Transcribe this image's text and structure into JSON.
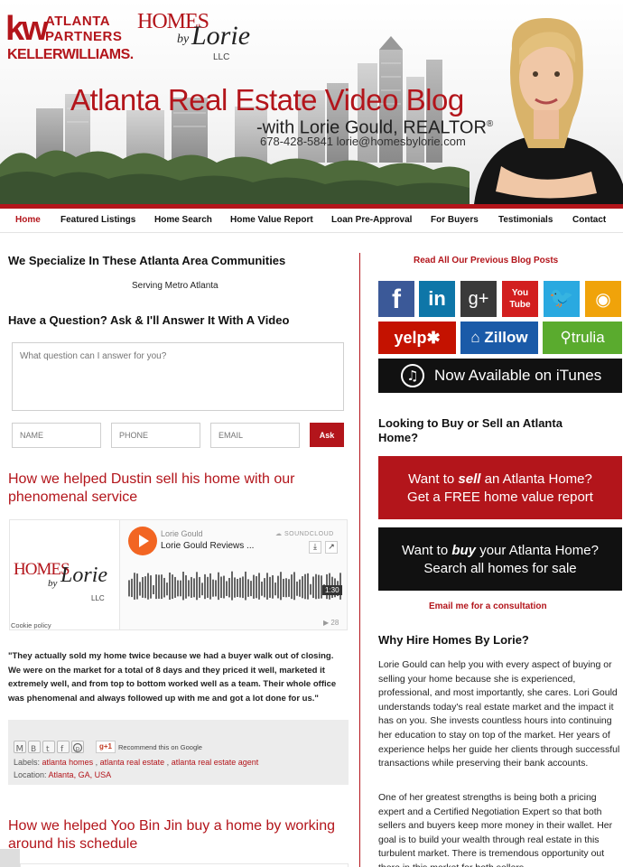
{
  "brand": {
    "kw_mark": "kw",
    "kw_line1": "ATLANTA",
    "kw_line2": "PARTNERS",
    "kw_name": "KELLERWILLIAMS.",
    "homes": "HOMES",
    "by": "by",
    "lorie": "Lorie",
    "llc": "LLC"
  },
  "header": {
    "title": "Atlanta Real Estate Video Blog",
    "subtitle": "-with Lorie Gould, REALTOR",
    "subtitle_mark": "®",
    "contact": "678-428-5841 lorie@homesbylorie.com"
  },
  "nav": {
    "items": [
      "Home",
      "Featured Listings",
      "Home Search",
      "Home Value Report",
      "Loan Pre-Approval",
      "For Buyers",
      "Testimonials",
      "Contact"
    ]
  },
  "main": {
    "communities_heading": "We Specialize In These Atlanta Area Communities",
    "communities_sub": "Serving Metro Atlanta",
    "question_heading": "Have a Question? Ask & I'll Answer It With A Video",
    "question_placeholder": "What question can I answer for you?",
    "name_placeholder": "NAME",
    "phone_placeholder": "PHONE",
    "email_placeholder": "EMAIL",
    "ask_label": "Ask",
    "post1_title": "How we helped Dustin sell his home with our phenomenal service",
    "player": {
      "artist": "Lorie Gould",
      "track": "Lorie Gould Reviews ...",
      "provider": "SOUNDCLOUD",
      "duration": "1:30",
      "plays": "28",
      "cookie": "Cookie policy"
    },
    "post1_quote": "\"They actually sold my home twice because we had a buyer walk out of closing. We were on the market for a total of 8 days and they priced it well, marketed it extremely well, and from top to bottom worked well as a team. Their whole office was phenomenal and always followed up with me and got a lot done for us.\"",
    "share": {
      "gplus": "g+1",
      "recommend": "Recommend this on Google"
    },
    "labels_prefix": "Labels:",
    "labels": [
      "atlanta homes",
      "atlanta real estate",
      "atlanta real estate agent"
    ],
    "location_prefix": "Location:",
    "location": "Atlanta, GA, USA",
    "post2_title": "How we helped Yoo Bin Jin buy a home by working around his schedule"
  },
  "sidebar": {
    "read_all": "Read All Our Previous Blog Posts",
    "social": [
      {
        "name": "facebook",
        "glyph": "f",
        "color": "#3b5998"
      },
      {
        "name": "linkedin",
        "glyph": "in",
        "color": "#0e76a8"
      },
      {
        "name": "googleplus",
        "glyph": "g+",
        "color": "#3a3a3a"
      },
      {
        "name": "youtube",
        "glyph": "You Tube",
        "color": "#d21f1f"
      },
      {
        "name": "twitter",
        "glyph": "🐦",
        "color": "#2aa9e0"
      },
      {
        "name": "rss",
        "glyph": "◉",
        "color": "#f0a30a"
      }
    ],
    "yelp": "yelp✱",
    "zillow": "Zillow",
    "trulia": "trulia",
    "itunes": "Now Available on iTunes",
    "looking_heading": "Looking to Buy or Sell an Atlanta Home?",
    "sell_cta_pre": "Want to ",
    "sell_cta_em": "sell",
    "sell_cta_post": " an Atlanta Home?",
    "sell_cta_line2": "Get a FREE home value report",
    "buy_cta_pre": "Want to ",
    "buy_cta_em": "buy",
    "buy_cta_post": " your Atlanta Home?",
    "buy_cta_line2": "Search all homes for sale",
    "email_link": "Email me for a consultation",
    "why_heading": "Why Hire Homes By Lorie?",
    "why_p1": "Lorie Gould can help you with every aspect of buying or selling your home because she is experienced, professional, and most importantly, she cares. Lori Gould understands today's real estate market and the impact it has on you. She invests countless hours into continuing her education to stay on top of the market. Her years of experience helps her guide her clients through successful transactions while preserving their bank accounts.",
    "why_p2": "One of her greatest strengths is being both a pricing expert and a Certified Negotiation Expert so that both sellers and buyers keep more money in their wallet. Her goal is to build your wealth through real estate in this turbulent market. There is tremendous opportunity out there in this market for both sellers"
  },
  "colors": {
    "brand_red": "#b3151b",
    "soundcloud_orange": "#f26522",
    "yelp": "#c41200",
    "zillow": "#1a5aa8",
    "trulia": "#5aab2e",
    "itunes_bg": "#111111"
  }
}
